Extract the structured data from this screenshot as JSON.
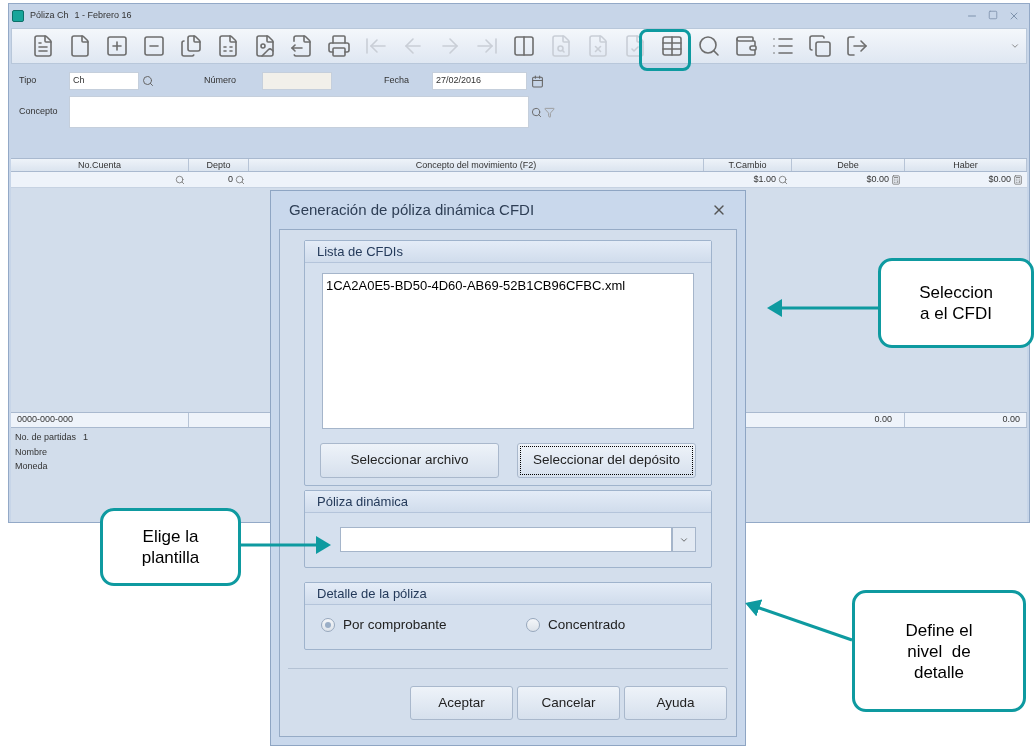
{
  "window": {
    "title": "Póliza Ch",
    "subtitle": "1 - Febrero 16"
  },
  "form": {
    "tipo_label": "Tipo",
    "tipo_value": "Ch",
    "numero_label": "Número",
    "fecha_label": "Fecha",
    "fecha_value": "27/02/2016",
    "concepto_label": "Concepto"
  },
  "table": {
    "columns": [
      "No.Cuenta",
      "Depto",
      "Concepto del movimiento (F2)",
      "T.Cambio",
      "Debe",
      "Haber"
    ],
    "rows": [
      [
        "",
        "0",
        "",
        "$1.00",
        "$0.00",
        "$0.00"
      ]
    ]
  },
  "totals": {
    "account": "0000-000-000",
    "debe": "0.00",
    "haber": "0.00"
  },
  "footer": [
    {
      "label": "No. de partidas",
      "value": "1"
    },
    {
      "label": "Nombre"
    },
    {
      "label": "Moneda"
    }
  ],
  "dialog": {
    "title": "Generación de póliza dinámica CFDI",
    "list_group": {
      "title": "Lista de CFDIs",
      "items": [
        "1CA2A0E5-BD50-4D60-AB69-52B1CB96CFBC.xml"
      ],
      "buttons": [
        {
          "label": "Seleccionar archivo",
          "focused": false
        },
        {
          "label": "Seleccionar del depósito",
          "focused": true
        }
      ]
    },
    "template_group": {
      "title": "Póliza dinámica"
    },
    "detail_group": {
      "title": "Detalle de la póliza",
      "options": [
        {
          "label": "Por comprobante",
          "selected": true
        },
        {
          "label": "Concentrado",
          "selected": false
        }
      ]
    },
    "buttons": [
      "Aceptar",
      "Cancelar",
      "Ayuda"
    ]
  },
  "callouts": [
    {
      "lines": [
        "Seleccion",
        "a el CFDI"
      ]
    },
    {
      "lines": [
        "Elige la",
        "plantilla"
      ]
    },
    {
      "lines": [
        "Define el",
        "nivel  de",
        "detalle"
      ]
    }
  ]
}
